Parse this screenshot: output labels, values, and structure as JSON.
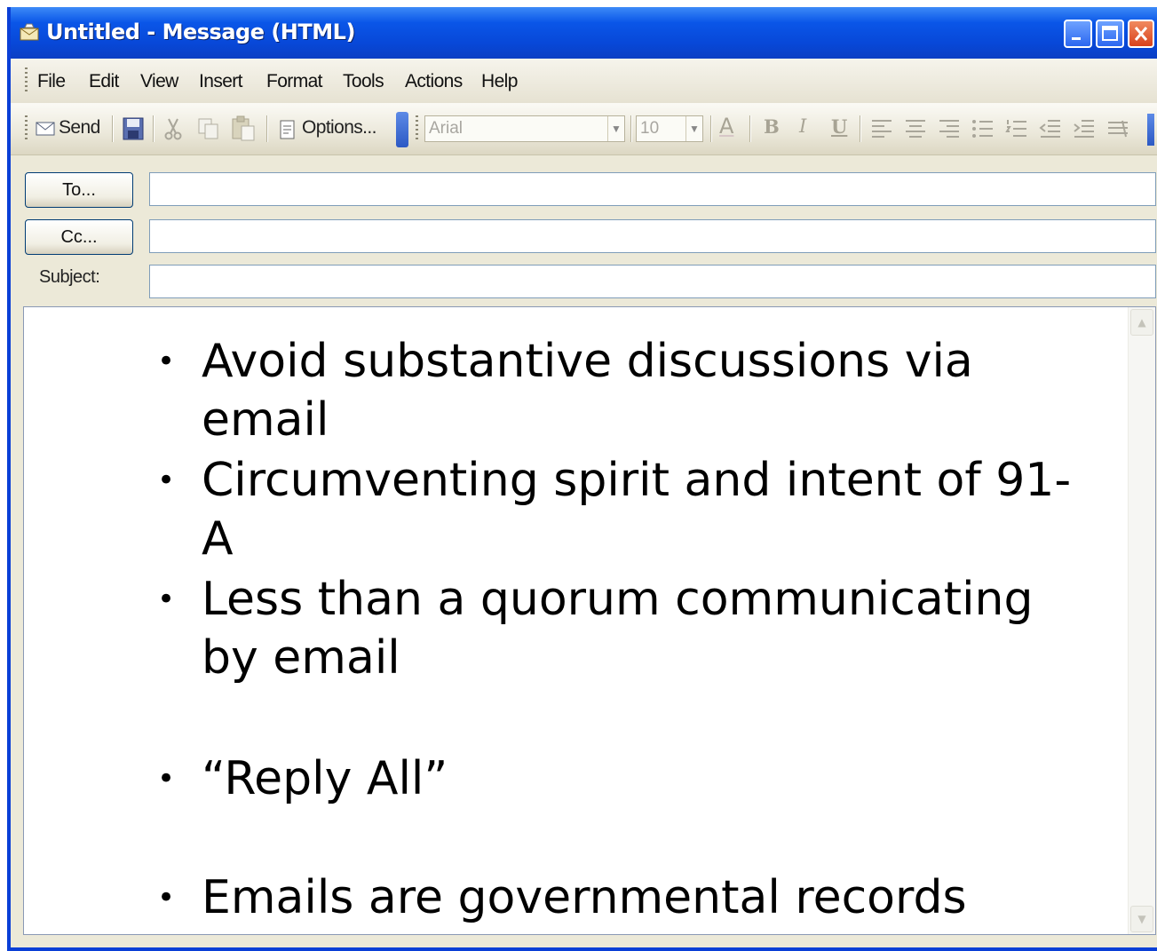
{
  "window": {
    "title": "Untitled - Message (HTML)"
  },
  "menu": [
    "File",
    "Edit",
    "View",
    "Insert",
    "Format",
    "Tools",
    "Actions",
    "Help"
  ],
  "toolbar": {
    "send_label": "Send",
    "options_label": "Options...",
    "font_value": "Arial",
    "size_value": "10",
    "bold_label": "B",
    "italic_label": "I",
    "underline_label": "U",
    "font_color_label": "A"
  },
  "header": {
    "to_button": "To...",
    "cc_button": "Cc...",
    "subject_label": "Subject:",
    "to_value": "",
    "cc_value": "",
    "subject_value": ""
  },
  "body": {
    "bullets": [
      "Avoid substantive discussions via email",
      "Circumventing spirit and intent of 91-A",
      "Less than a quorum communicating by email",
      "“Reply All”",
      "Emails are governmental records"
    ]
  },
  "icons": {
    "title": "envelope-icon",
    "minimize": "minimize-icon",
    "maximize": "maximize-icon",
    "close": "close-icon",
    "send": "send-envelope-icon",
    "save": "save-disk-icon",
    "cut": "cut-icon",
    "copy": "copy-icon",
    "paste": "paste-icon",
    "options": "options-icon"
  },
  "colors": {
    "titlebar": "#0a56e8",
    "chrome": "#ece9d8",
    "input_border": "#7f9db9"
  }
}
